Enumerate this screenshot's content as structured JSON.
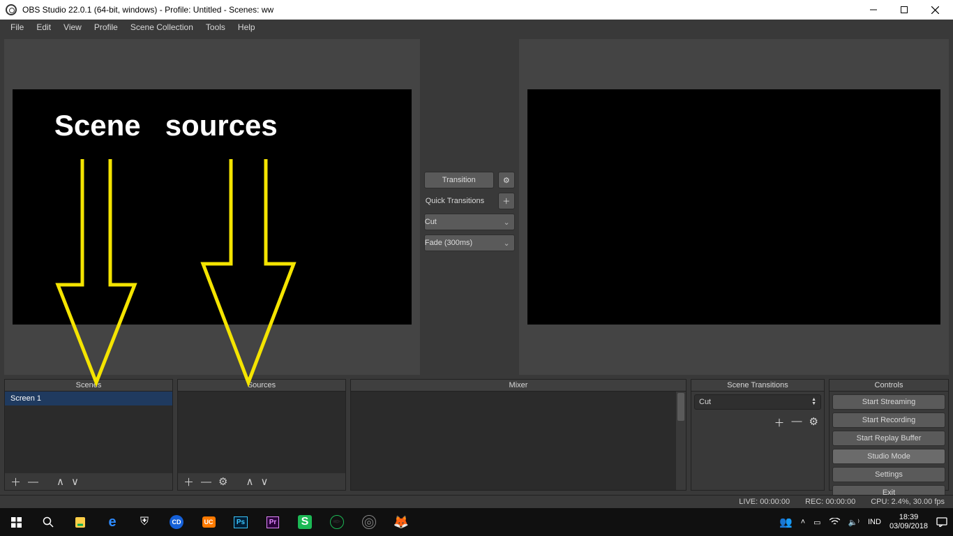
{
  "window": {
    "title": "OBS Studio 22.0.1 (64-bit, windows) - Profile: Untitled - Scenes: ww"
  },
  "menu": {
    "file": "File",
    "edit": "Edit",
    "view": "View",
    "profile": "Profile",
    "scene_collection": "Scene Collection",
    "tools": "Tools",
    "help": "Help"
  },
  "overlay": {
    "scene_word": "Scene",
    "sources_word": "sources"
  },
  "center": {
    "transition_btn": "Transition",
    "qt_label": "Quick Transitions",
    "cut": "Cut",
    "fade": "Fade (300ms)"
  },
  "docks": {
    "scenes_title": "Scenes",
    "sources_title": "Sources",
    "mixer_title": "Mixer",
    "trans_title": "Scene Transitions",
    "controls_title": "Controls"
  },
  "scenes": {
    "items": [
      "Screen 1"
    ]
  },
  "transitions": {
    "selected": "Cut"
  },
  "controls": {
    "start_streaming": "Start Streaming",
    "start_recording": "Start Recording",
    "start_replay": "Start Replay Buffer",
    "studio_mode": "Studio Mode",
    "settings": "Settings",
    "exit": "Exit"
  },
  "status": {
    "live": "LIVE: 00:00:00",
    "rec": "REC: 00:00:00",
    "cpu": "CPU: 2.4%, 30.00 fps"
  },
  "taskbar": {
    "lang": "IND",
    "time": "18:39",
    "date": "03/09/2018"
  }
}
